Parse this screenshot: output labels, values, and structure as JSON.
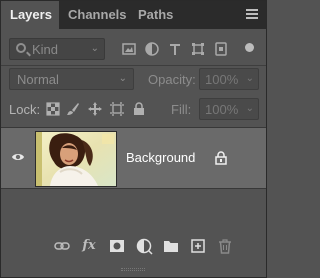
{
  "tabs": [
    {
      "label": "Layers",
      "active": true
    },
    {
      "label": "Channels",
      "active": false
    },
    {
      "label": "Paths",
      "active": false
    }
  ],
  "filter": {
    "kind_label": "Kind",
    "icons": [
      "pixel-layer-filter-icon",
      "adjustment-layer-filter-icon",
      "type-layer-filter-icon",
      "shape-layer-filter-icon",
      "smart-object-filter-icon"
    ]
  },
  "blend": {
    "mode": "Normal",
    "opacity_label": "Opacity:",
    "opacity_value": "100%"
  },
  "lock": {
    "label": "Lock:",
    "icons": [
      "lock-transparent-pixels-icon",
      "lock-image-pixels-icon",
      "lock-position-icon",
      "lock-artboard-icon",
      "lock-all-icon"
    ],
    "fill_label": "Fill:",
    "fill_value": "100%"
  },
  "layers": [
    {
      "name": "Background",
      "visible": true,
      "locked": true
    }
  ],
  "bottom_icons": [
    "link-layers-icon",
    "add-layer-style-icon",
    "add-layer-mask-icon",
    "new-adjustment-layer-icon",
    "new-group-icon",
    "new-layer-icon",
    "delete-layer-icon"
  ],
  "colors": {
    "panel": "#535353",
    "tabbar": "#2b2b2b",
    "selected_layer": "#6a6a6a"
  }
}
